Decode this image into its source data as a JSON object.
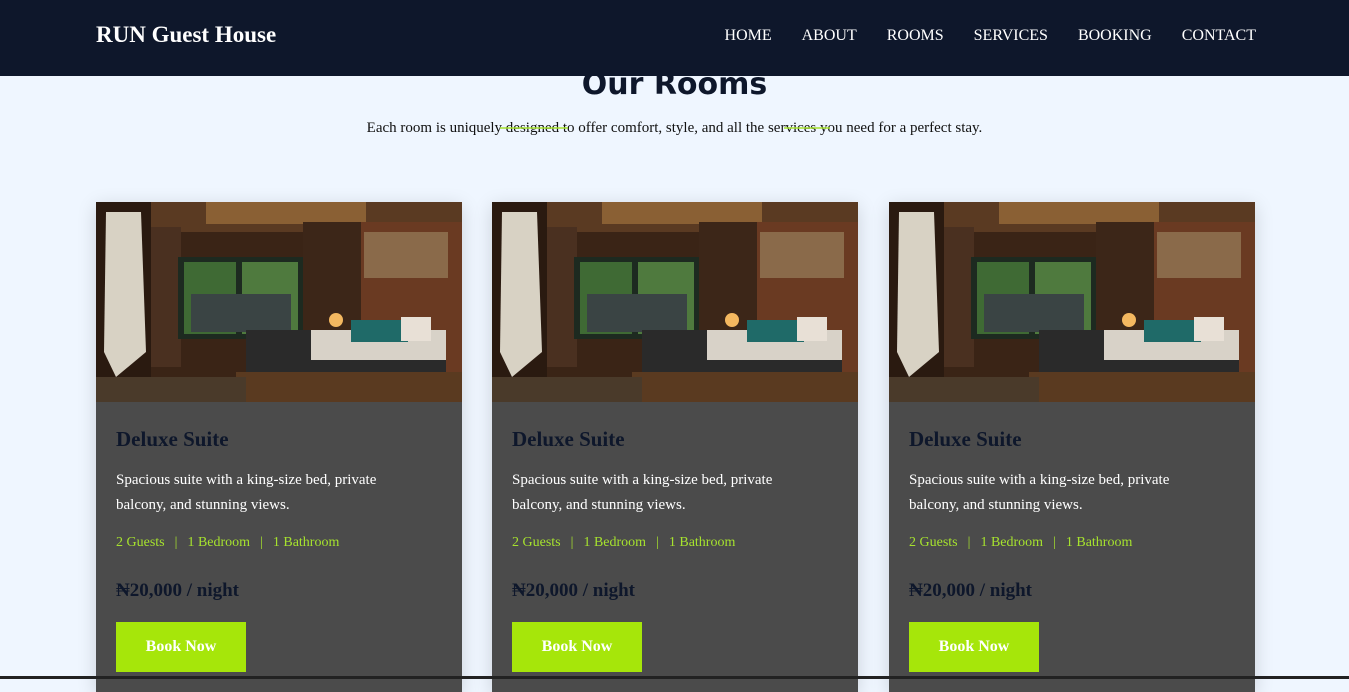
{
  "navbar": {
    "brand": "RUN Guest House",
    "links": [
      "HOME",
      "ABOUT",
      "ROOMS",
      "SERVICES",
      "BOOKING",
      "CONTACT"
    ]
  },
  "section": {
    "title": "Our Rooms",
    "subtitle": "Each room is uniquely designed to offer comfort, style, and all the services you need for a perfect stay."
  },
  "rooms": [
    {
      "title": "Deluxe Suite",
      "description": "Spacious suite with a king-size bed, private balcony, and stunning views.",
      "features": [
        "2 Guests",
        "1 Bedroom",
        "1 Bathroom"
      ],
      "price": "₦20,000 / night",
      "button": "Book Now"
    },
    {
      "title": "Deluxe Suite",
      "description": "Spacious suite with a king-size bed, private balcony, and stunning views.",
      "features": [
        "2 Guests",
        "1 Bedroom",
        "1 Bathroom"
      ],
      "price": "₦20,000 / night",
      "button": "Book Now"
    },
    {
      "title": "Deluxe Suite",
      "description": "Spacious suite with a king-size bed, private balcony, and stunning views.",
      "features": [
        "2 Guests",
        "1 Bedroom",
        "1 Bathroom"
      ],
      "price": "₦20,000 / night",
      "button": "Book Now"
    }
  ],
  "separator": "|",
  "colors": {
    "navbar_bg": "#0e172b",
    "page_bg": "#eff6ff",
    "card_bg": "#4b4b4b",
    "accent": "#a6e60a"
  }
}
